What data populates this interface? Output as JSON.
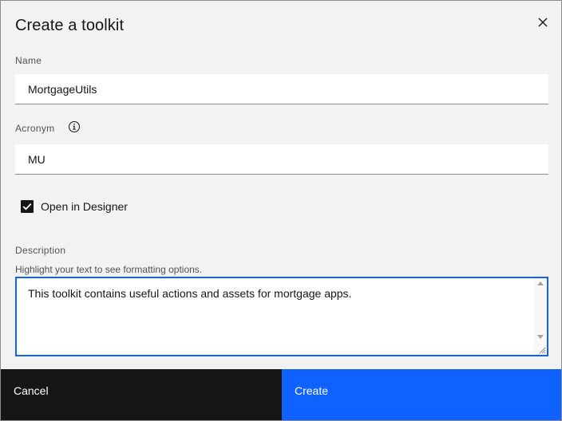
{
  "dialog": {
    "title": "Create a toolkit",
    "close_icon": "close-icon"
  },
  "form": {
    "name": {
      "label": "Name",
      "value": "MortgageUtils"
    },
    "acronym": {
      "label": "Acronym",
      "value": "MU",
      "info_icon": "info-icon"
    },
    "open_in_designer": {
      "label": "Open in Designer",
      "checked": true
    },
    "description": {
      "label": "Description",
      "helper": "Highlight your text to see formatting options.",
      "value": "This toolkit contains useful actions and assets for mortgage apps."
    }
  },
  "footer": {
    "cancel_label": "Cancel",
    "create_label": "Create"
  },
  "colors": {
    "primary": "#0f62fe",
    "secondary": "#161616",
    "field_bg": "#ffffff",
    "dialog_bg": "#f2f2f2"
  }
}
